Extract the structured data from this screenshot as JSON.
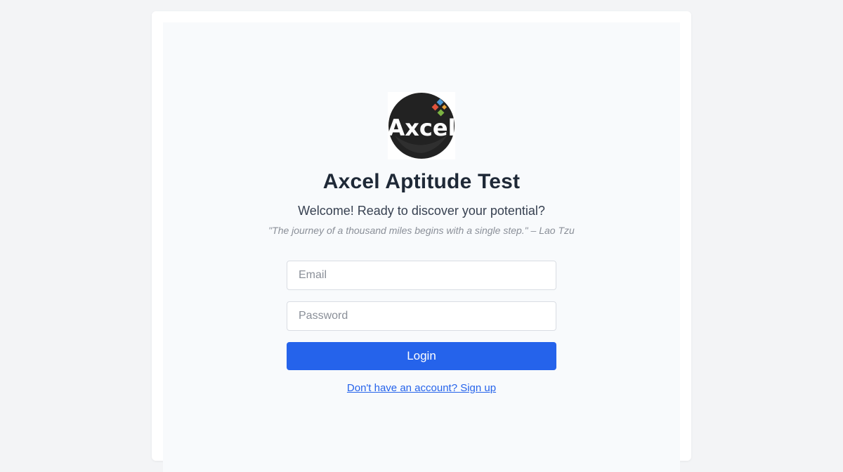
{
  "brand": {
    "logo_text": "Axcel",
    "logo_icon": "axcel-logo",
    "logo_colors": {
      "circle": "#222222",
      "text": "#ffffff",
      "sq_blue": "#4b9ad8",
      "sq_red": "#e0533d",
      "sq_green": "#7cb342",
      "sq_orange": "#e8a33a"
    }
  },
  "header": {
    "title": "Axcel Aptitude Test",
    "subtitle": "Welcome! Ready to discover your potential?",
    "quote": "\"The journey of a thousand miles begins with a single step.\" – Lao Tzu"
  },
  "form": {
    "email_placeholder": "Email",
    "email_value": "",
    "password_placeholder": "Password",
    "password_value": "",
    "login_label": "Login"
  },
  "footer": {
    "signup_link": "Don't have an account? Sign up"
  },
  "colors": {
    "page_bg": "#f3f4f6",
    "card_bg": "#ffffff",
    "panel_bg": "#f8fafc",
    "primary": "#2563eb",
    "title": "#1f2937"
  }
}
